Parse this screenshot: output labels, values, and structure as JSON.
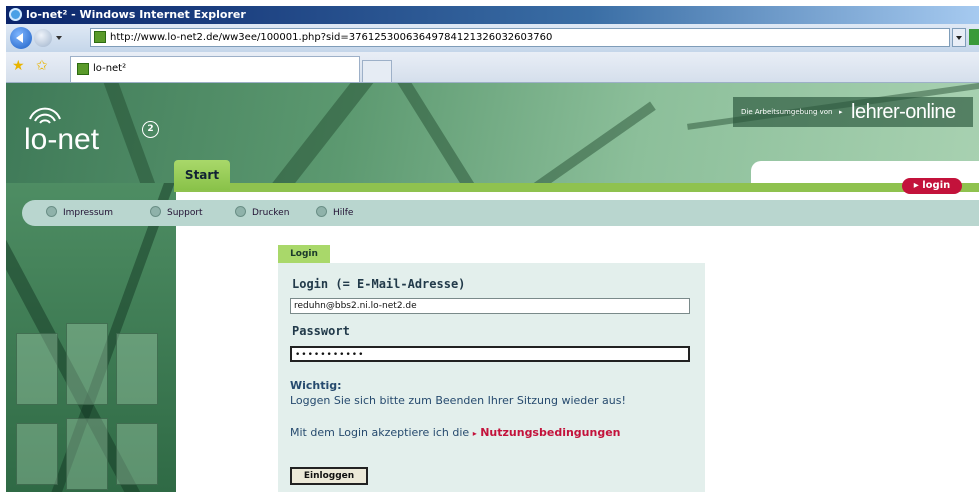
{
  "window": {
    "title": "lo-net² - Windows Internet Explorer"
  },
  "address": {
    "url": "http://www.lo-net2.de/ww3ee/100001.php?sid=37612530063649784121326032603760"
  },
  "tabs": [
    {
      "label": "lo-net²"
    }
  ],
  "site": {
    "logo_text": "lo-net",
    "logo_sup": "2",
    "partner_prefix": "Die Arbeitsumgebung von",
    "partner_arrow": "▸",
    "partner_brand": "lehrer-online"
  },
  "nav": {
    "start_tab": "Start",
    "login_button": "▸ login",
    "menu": [
      {
        "label": "Impressum",
        "icon": "info-icon"
      },
      {
        "label": "Support",
        "icon": "support-icon"
      },
      {
        "label": "Drucken",
        "icon": "print-icon"
      },
      {
        "label": "Hilfe",
        "icon": "help-icon"
      }
    ]
  },
  "login_form": {
    "tab": "Login",
    "email_label": "Login (= E-Mail-Adresse)",
    "email_value": "reduhn@bbs2.ni.lo-net2.de",
    "password_label": "Passwort",
    "password_value": "•••••••••••",
    "important_title": "Wichtig:",
    "important_text": "Loggen Sie sich bitte zum Beenden Ihrer Sitzung wieder aus!",
    "accept_text": "Mit dem Login akzeptiere ich die",
    "accept_arrow": "▸",
    "accept_link": "Nutzungsbedingungen",
    "submit": "Einloggen"
  },
  "colors": {
    "accent_green": "#8fc24f",
    "login_red": "#c3123b",
    "form_bg": "#e3efec",
    "menu_bg": "#b9d6cf"
  }
}
